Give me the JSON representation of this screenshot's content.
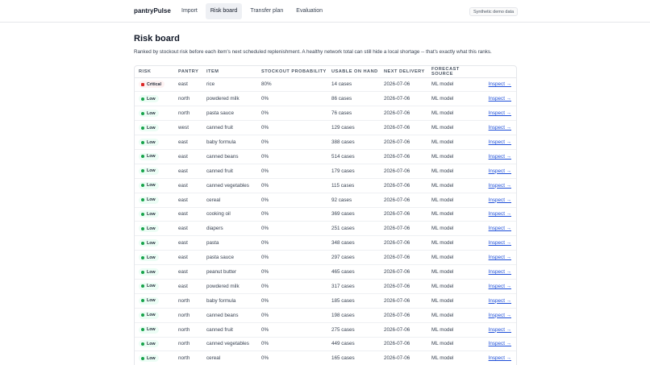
{
  "app": {
    "brand": "pantryPulse",
    "demo_badge": "Synthetic demo data"
  },
  "nav": {
    "items": [
      {
        "label": "Import"
      },
      {
        "label": "Risk board"
      },
      {
        "label": "Transfer plan"
      },
      {
        "label": "Evaluation"
      }
    ],
    "active": "Risk board"
  },
  "page": {
    "title": "Risk board",
    "description": "Ranked by stockout risk before each item's next scheduled replenishment. A healthy network total can still hide a local shortage -- that's exactly what this ranks."
  },
  "table": {
    "headers": {
      "risk": "Risk",
      "pantry": "Pantry",
      "item": "Item",
      "prob": "Stockout probability",
      "onhand": "Usable on hand",
      "delivery": "Next delivery",
      "source": "Forecast source"
    },
    "action_label": "Inspect →",
    "rows": [
      {
        "risk": "Critical",
        "level": "critical",
        "pantry": "east",
        "item": "rice",
        "prob": "80%",
        "onhand": "14 cases",
        "delivery": "2026-07-06",
        "source": "ML model"
      },
      {
        "risk": "Low",
        "level": "low",
        "pantry": "north",
        "item": "powdered milk",
        "prob": "0%",
        "onhand": "86 cases",
        "delivery": "2026-07-06",
        "source": "ML model"
      },
      {
        "risk": "Low",
        "level": "low",
        "pantry": "north",
        "item": "pasta sauce",
        "prob": "0%",
        "onhand": "76 cases",
        "delivery": "2026-07-06",
        "source": "ML model"
      },
      {
        "risk": "Low",
        "level": "low",
        "pantry": "west",
        "item": "canned fruit",
        "prob": "0%",
        "onhand": "129 cases",
        "delivery": "2026-07-06",
        "source": "ML model"
      },
      {
        "risk": "Low",
        "level": "low",
        "pantry": "east",
        "item": "baby formula",
        "prob": "0%",
        "onhand": "388 cases",
        "delivery": "2026-07-06",
        "source": "ML model"
      },
      {
        "risk": "Low",
        "level": "low",
        "pantry": "east",
        "item": "canned beans",
        "prob": "0%",
        "onhand": "514 cases",
        "delivery": "2026-07-06",
        "source": "ML model"
      },
      {
        "risk": "Low",
        "level": "low",
        "pantry": "east",
        "item": "canned fruit",
        "prob": "0%",
        "onhand": "179 cases",
        "delivery": "2026-07-06",
        "source": "ML model"
      },
      {
        "risk": "Low",
        "level": "low",
        "pantry": "east",
        "item": "canned vegetables",
        "prob": "0%",
        "onhand": "115 cases",
        "delivery": "2026-07-06",
        "source": "ML model"
      },
      {
        "risk": "Low",
        "level": "low",
        "pantry": "east",
        "item": "cereal",
        "prob": "0%",
        "onhand": "92 cases",
        "delivery": "2026-07-06",
        "source": "ML model"
      },
      {
        "risk": "Low",
        "level": "low",
        "pantry": "east",
        "item": "cooking oil",
        "prob": "0%",
        "onhand": "369 cases",
        "delivery": "2026-07-06",
        "source": "ML model"
      },
      {
        "risk": "Low",
        "level": "low",
        "pantry": "east",
        "item": "diapers",
        "prob": "0%",
        "onhand": "251 cases",
        "delivery": "2026-07-06",
        "source": "ML model"
      },
      {
        "risk": "Low",
        "level": "low",
        "pantry": "east",
        "item": "pasta",
        "prob": "0%",
        "onhand": "348 cases",
        "delivery": "2026-07-06",
        "source": "ML model"
      },
      {
        "risk": "Low",
        "level": "low",
        "pantry": "east",
        "item": "pasta sauce",
        "prob": "0%",
        "onhand": "297 cases",
        "delivery": "2026-07-06",
        "source": "ML model"
      },
      {
        "risk": "Low",
        "level": "low",
        "pantry": "east",
        "item": "peanut butter",
        "prob": "0%",
        "onhand": "465 cases",
        "delivery": "2026-07-06",
        "source": "ML model"
      },
      {
        "risk": "Low",
        "level": "low",
        "pantry": "east",
        "item": "powdered milk",
        "prob": "0%",
        "onhand": "317 cases",
        "delivery": "2026-07-06",
        "source": "ML model"
      },
      {
        "risk": "Low",
        "level": "low",
        "pantry": "north",
        "item": "baby formula",
        "prob": "0%",
        "onhand": "185 cases",
        "delivery": "2026-07-06",
        "source": "ML model"
      },
      {
        "risk": "Low",
        "level": "low",
        "pantry": "north",
        "item": "canned beans",
        "prob": "0%",
        "onhand": "198 cases",
        "delivery": "2026-07-06",
        "source": "ML model"
      },
      {
        "risk": "Low",
        "level": "low",
        "pantry": "north",
        "item": "canned fruit",
        "prob": "0%",
        "onhand": "275 cases",
        "delivery": "2026-07-06",
        "source": "ML model"
      },
      {
        "risk": "Low",
        "level": "low",
        "pantry": "north",
        "item": "canned vegetables",
        "prob": "0%",
        "onhand": "449 cases",
        "delivery": "2026-07-06",
        "source": "ML model"
      },
      {
        "risk": "Low",
        "level": "low",
        "pantry": "north",
        "item": "cereal",
        "prob": "0%",
        "onhand": "165 cases",
        "delivery": "2026-07-06",
        "source": "ML model"
      }
    ]
  }
}
